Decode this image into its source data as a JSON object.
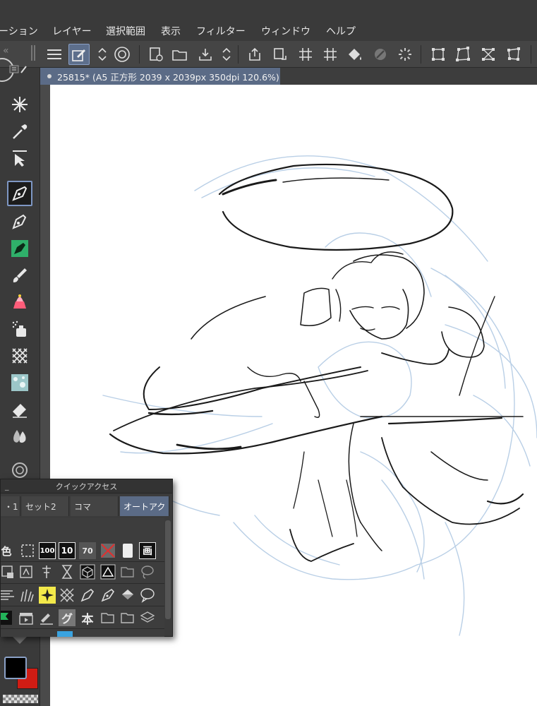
{
  "menubar": {
    "items": [
      "ーション",
      "レイヤー",
      "選択範囲",
      "表示",
      "フィルター",
      "ウィンドウ",
      "ヘルプ"
    ]
  },
  "toolbar": {
    "icons": [
      "menu-icon",
      "layer-settings-icon",
      "chevron-updown-icon",
      "spiral-logo-icon",
      "new-file-icon",
      "open-folder-icon",
      "save-icon",
      "chevron-updown-icon",
      "export-icon",
      "rotate-icon",
      "grid-icon",
      "grid-alt-icon",
      "fill-bucket-icon",
      "no-entry-icon",
      "loading-icon",
      "transform-icon",
      "distort-icon",
      "perspective-icon",
      "free-transform-icon"
    ]
  },
  "document": {
    "tab_label": "25815* (A5 正方形 2039 x 2039px 350dpi 120.6%)"
  },
  "quick_access": {
    "title": "クイックアクセス",
    "tabs": [
      "・1",
      "セット2",
      "コマ",
      "オートアク"
    ],
    "selected_tab": "オートアク",
    "row1_labels": [
      "色",
      "",
      "100",
      "10",
      "70",
      "",
      "",
      "画"
    ],
    "row4_labels": [
      "",
      "",
      "",
      "グ",
      "本",
      "",
      "",
      ""
    ]
  },
  "colors": {
    "foreground": "#000000",
    "background": "#d01c14",
    "accent": "#5b6b86",
    "sketch_line": "#1a1a1a",
    "rough_line": "#b9cfe6"
  }
}
